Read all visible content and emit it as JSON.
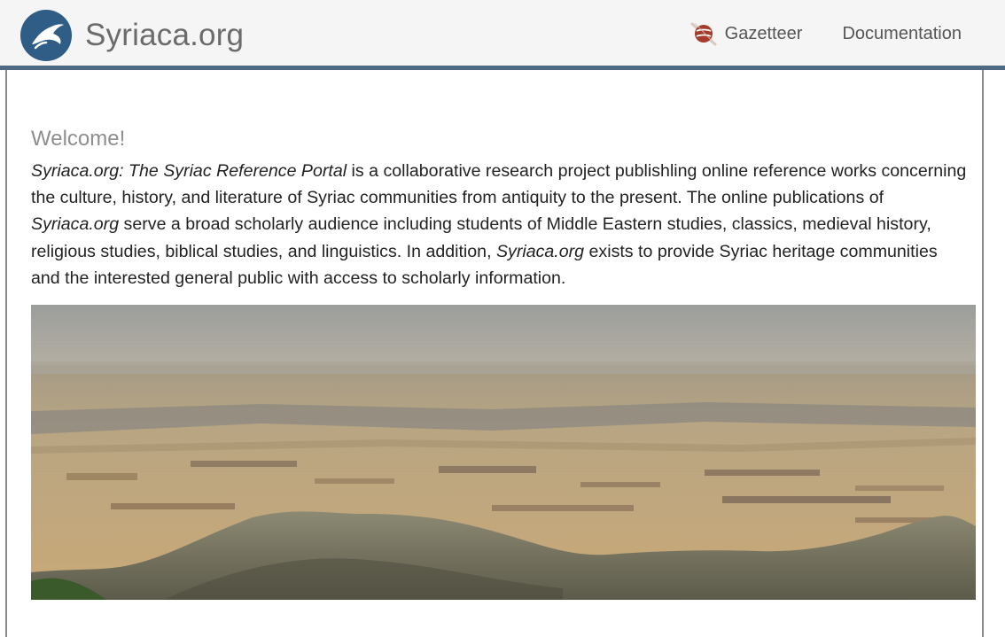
{
  "site": {
    "brand_name": "Syriaca.org",
    "logo_icon": "syriaca-bird-logo-icon",
    "brand_color": "#2f5d86"
  },
  "nav": {
    "items": [
      {
        "label": "Gazetteer",
        "icon": "gazetteer-icon",
        "icon_color": "#a63a2b"
      },
      {
        "label": "Documentation"
      }
    ]
  },
  "main": {
    "heading": "Welcome!",
    "intro": {
      "em1": "Syriaca.org: The Syriac Reference Portal",
      "t1": " is a collaborative research project publishling online reference works concerning the culture, history, and literature of Syriac communities from antiquity to the present. The online publications of ",
      "em2": "Syriaca.org",
      "t2": " serve a broad scholarly audience including students of Middle Eastern studies, classics, medieval history, religious studies, biblical studies, and linguistics. In addition, ",
      "em3": "Syriaca.org",
      "t3": " exists to provide Syriac heritage communities and the interested general public with access to scholarly information."
    }
  },
  "colors": {
    "navbar_bg": "#f5f5f5",
    "navbar_border": "#4d6a82",
    "heading": "#8e8e8e",
    "body_text": "#222222"
  }
}
